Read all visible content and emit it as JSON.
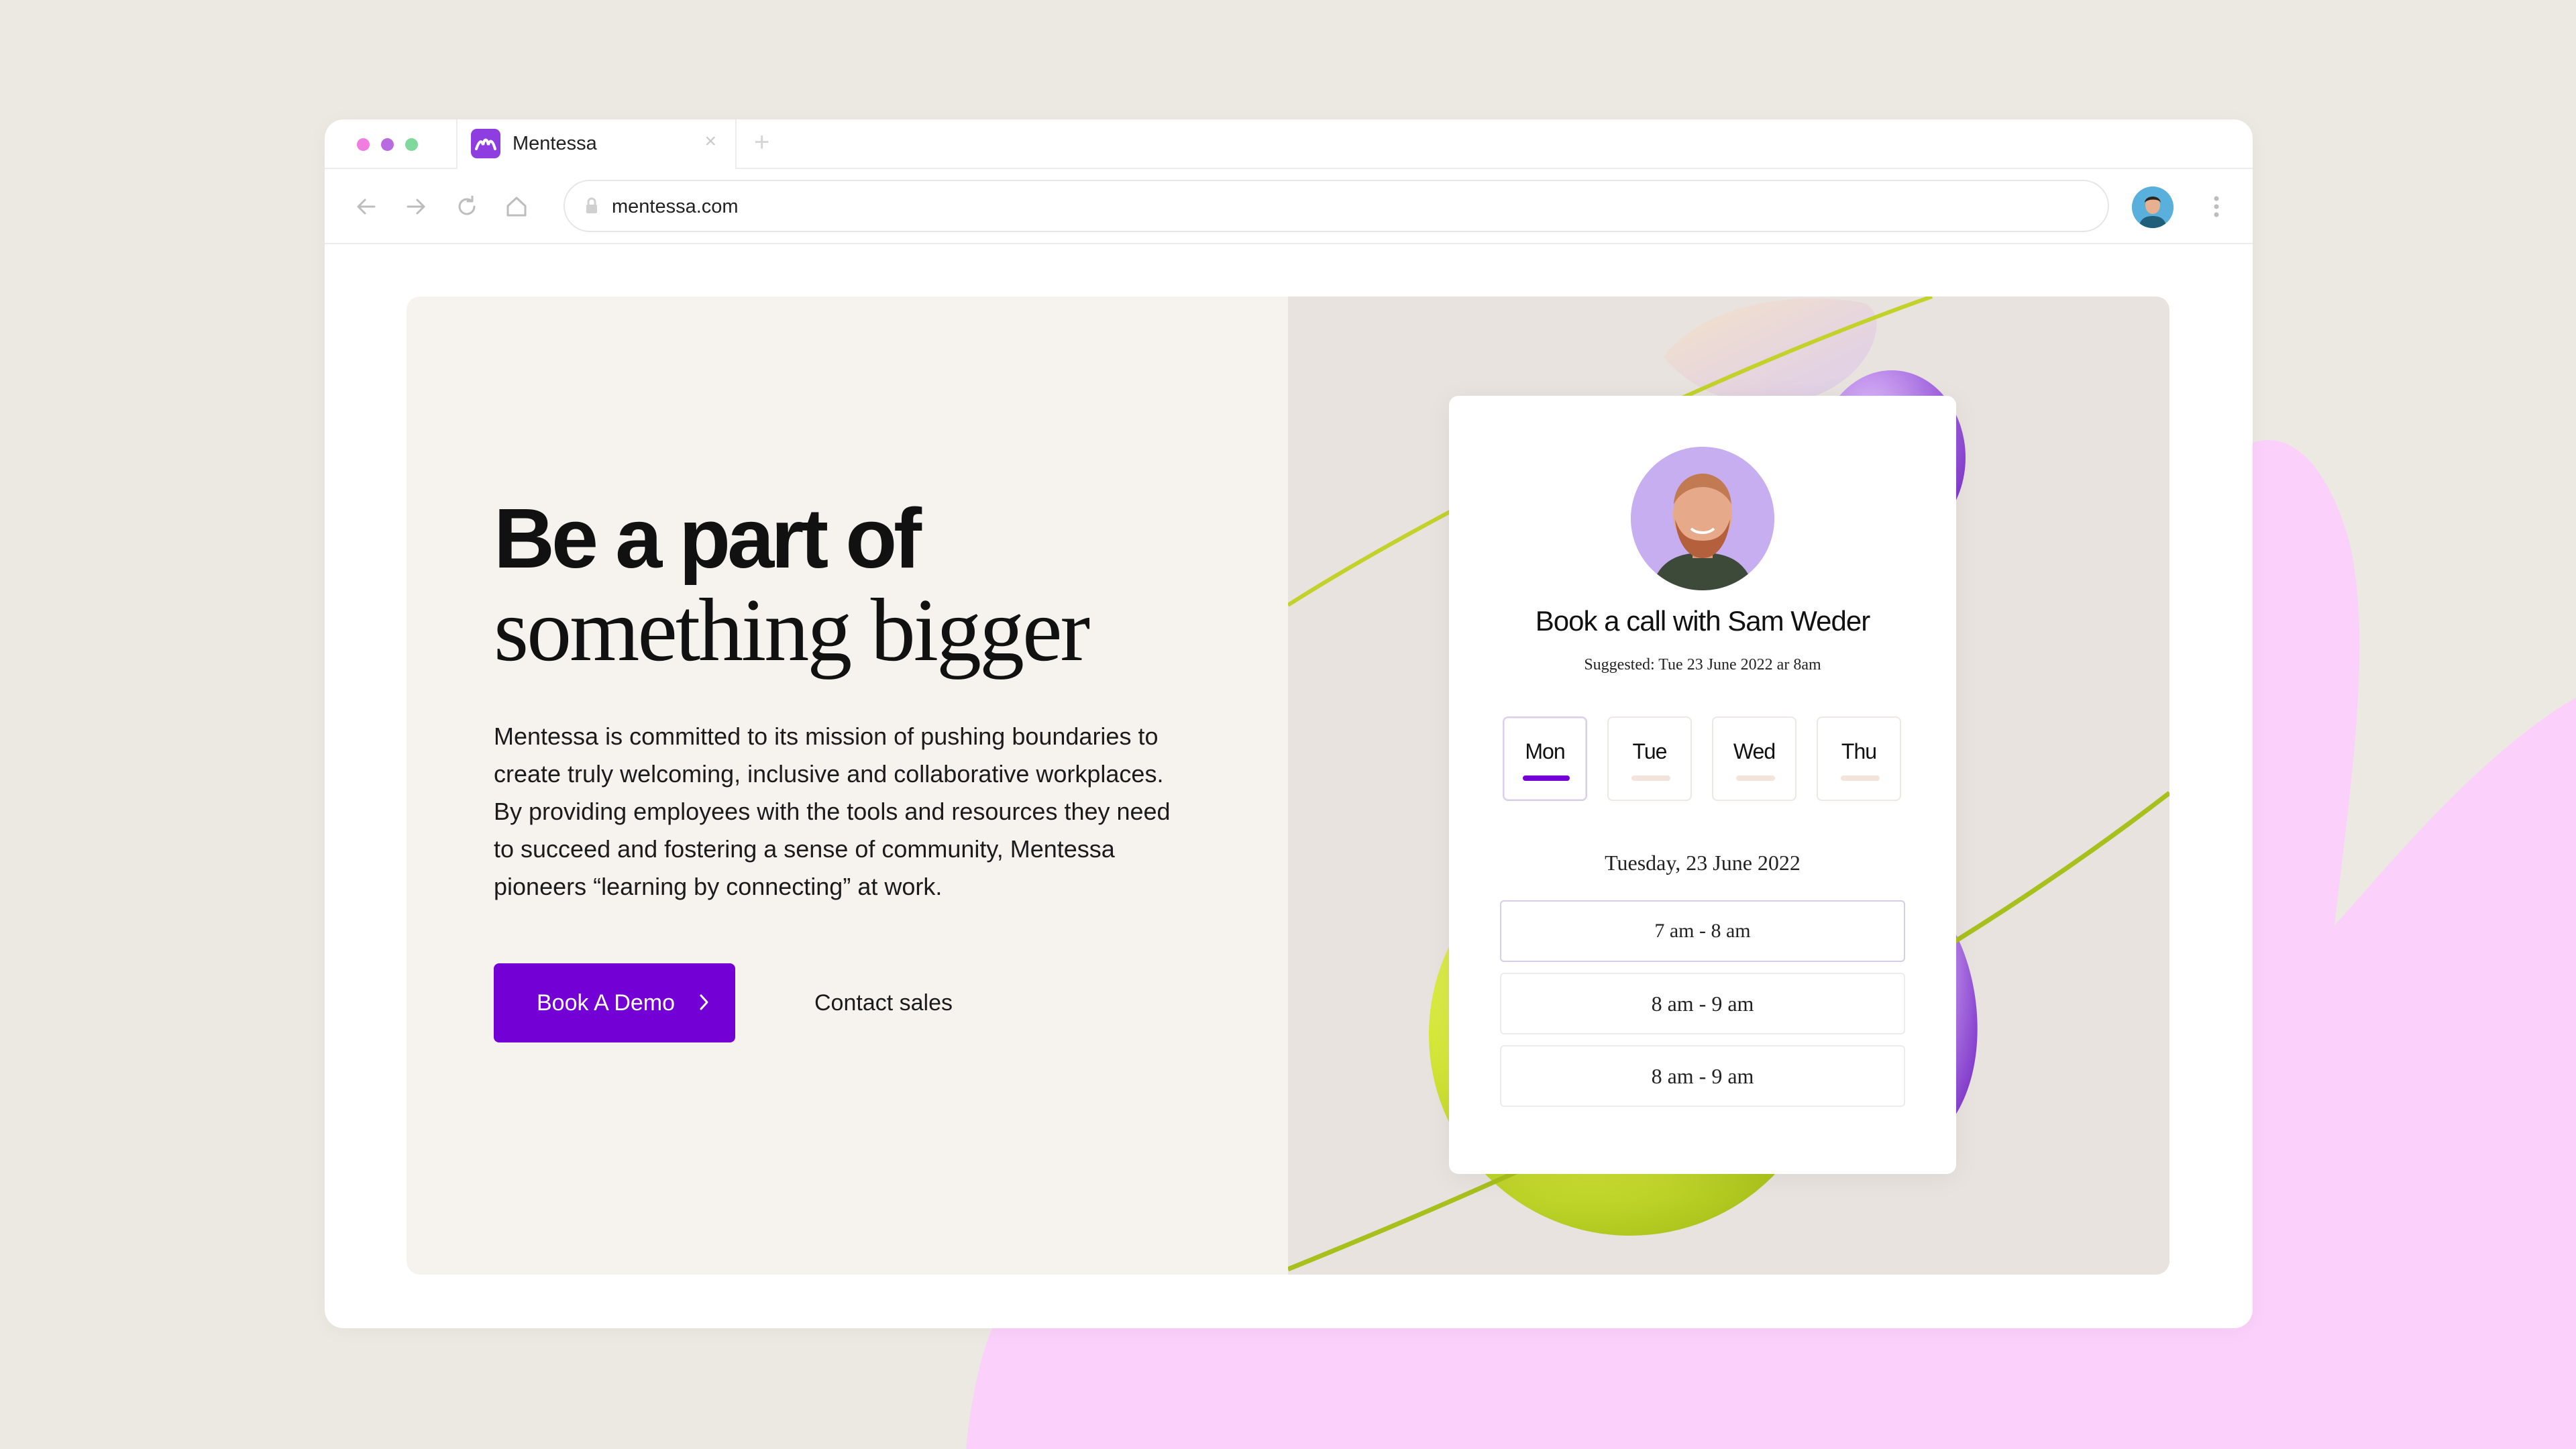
{
  "colors": {
    "page_background": "#ece9e3",
    "pink_blob": "#fbd0fb",
    "brand_purple": "#7300d5",
    "dot_red": "#f07ee1",
    "dot_yellow": "#b86ae0",
    "dot_green": "#7ed99a"
  },
  "browser": {
    "tab": {
      "title": "Mentessa",
      "favicon": "mentessa-logo-icon",
      "close_icon": "close-icon"
    },
    "new_tab_icon": "plus-icon",
    "toolbar": {
      "back_icon": "arrow-left-icon",
      "forward_icon": "arrow-right-icon",
      "reload_icon": "reload-icon",
      "home_icon": "home-icon",
      "address": "mentessa.com",
      "lock_icon": "lock-icon",
      "menu_icon": "kebab-menu-icon"
    }
  },
  "hero": {
    "headline_line1": "Be a part of",
    "headline_line2": "something bigger",
    "body": "Mentessa is committed to its mission of pushing boundaries to create truly welcoming, inclusive and collaborative workplaces. By providing employees with the tools and resources they need to succeed and fostering a sense of community, Mentessa pioneers “learning by connecting” at work.",
    "primary_button": "Book A Demo",
    "secondary_link": "Contact sales"
  },
  "booking": {
    "title": "Book a call with Sam Weder",
    "suggested": "Suggested: Tue 23 June 2022 ar 8am",
    "days": [
      {
        "label": "Mon",
        "active": true
      },
      {
        "label": "Tue",
        "active": false
      },
      {
        "label": "Wed",
        "active": false
      },
      {
        "label": "Thu",
        "active": false
      }
    ],
    "selected_date": "Tuesday, 23 June 2022",
    "slots": [
      {
        "label": "7 am - 8 am",
        "selected": true
      },
      {
        "label": "8 am - 9 am",
        "selected": false
      },
      {
        "label": "8 am - 9 am",
        "selected": false
      }
    ]
  }
}
